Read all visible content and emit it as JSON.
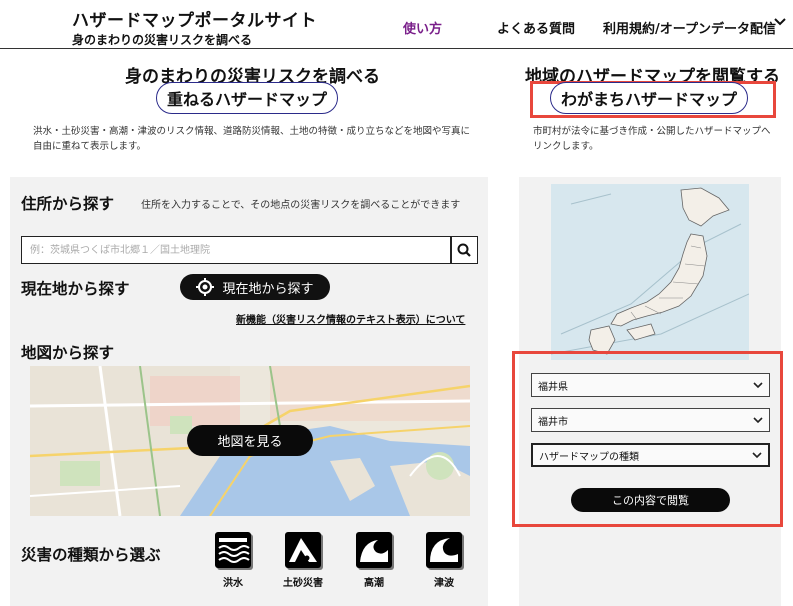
{
  "header": {
    "site_title": "ハザードマップポータルサイト",
    "site_subtitle": "身のまわりの災害リスクを調べる",
    "nav": {
      "usage": "使い方",
      "faq": "よくある質問",
      "terms": "利用規約/オープンデータ配信"
    }
  },
  "left": {
    "title": "身のまわりの災害リスクを調べる",
    "pill": "重ねるハザードマップ",
    "description": "洪水・土砂災害・高潮・津波のリスク情報、道路防災情報、土地の特徴・成り立ちなどを地図や写真に自由に重ねて表示します。",
    "address": {
      "title": "住所から探す",
      "hint": "住所を入力することで、その地点の災害リスクを調べることができます",
      "placeholder": "例：茨城県つくば市北郷１／国土地理院"
    },
    "location": {
      "title": "現在地から探す",
      "button": "現在地から探す",
      "new_feature_link": "新機能（災害リスク情報のテキスト表示）について"
    },
    "map": {
      "title": "地図から探す",
      "button": "地図を見る"
    },
    "disaster": {
      "title": "災害の種類から選ぶ",
      "items": [
        {
          "label": "洪水",
          "icon": "flood-icon"
        },
        {
          "label": "土砂災害",
          "icon": "landslide-icon"
        },
        {
          "label": "高潮",
          "icon": "storm-surge-icon"
        },
        {
          "label": "津波",
          "icon": "tsunami-icon"
        }
      ]
    }
  },
  "right": {
    "title": "地域のハザードマップを閲覧する",
    "pill": "わがまちハザードマップ",
    "description": "市町村が法令に基づき作成・公開したハザードマップへリンクします。",
    "prefecture": "福井県",
    "city": "福井市",
    "map_type": "ハザードマップの種類",
    "browse_button": "この内容で閲覧"
  },
  "colors": {
    "accent": "#7a1f8a",
    "highlight": "#e8473c",
    "pill_border": "#2b2b8a",
    "button": "#0a0a0a"
  }
}
